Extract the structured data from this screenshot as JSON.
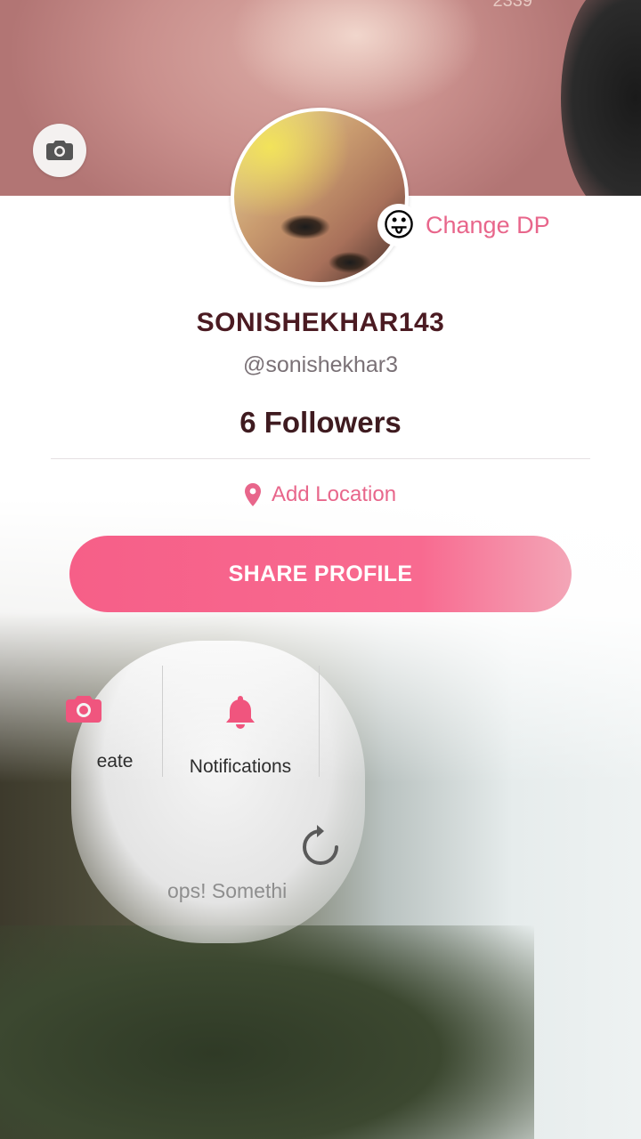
{
  "cover": {
    "count_partial": "2339"
  },
  "profile": {
    "change_dp_emoji": "😛",
    "change_dp_label": "Change DP",
    "username": "SONISHEKHAR143",
    "handle": "@sonishekhar3",
    "followers": "6 Followers",
    "location_label": "Add Location",
    "share_button": "SHARE PROFILE"
  },
  "actions": [
    {
      "label": "eate",
      "icon": "camera-icon"
    },
    {
      "label": "Notifications",
      "icon": "bell-icon"
    }
  ],
  "status": {
    "error_partial": "ops! Somethi",
    "icon": "refresh-icon"
  },
  "colors": {
    "accent": "#f65f88",
    "accent_text": "#e8668b",
    "title": "#4b1b22"
  }
}
